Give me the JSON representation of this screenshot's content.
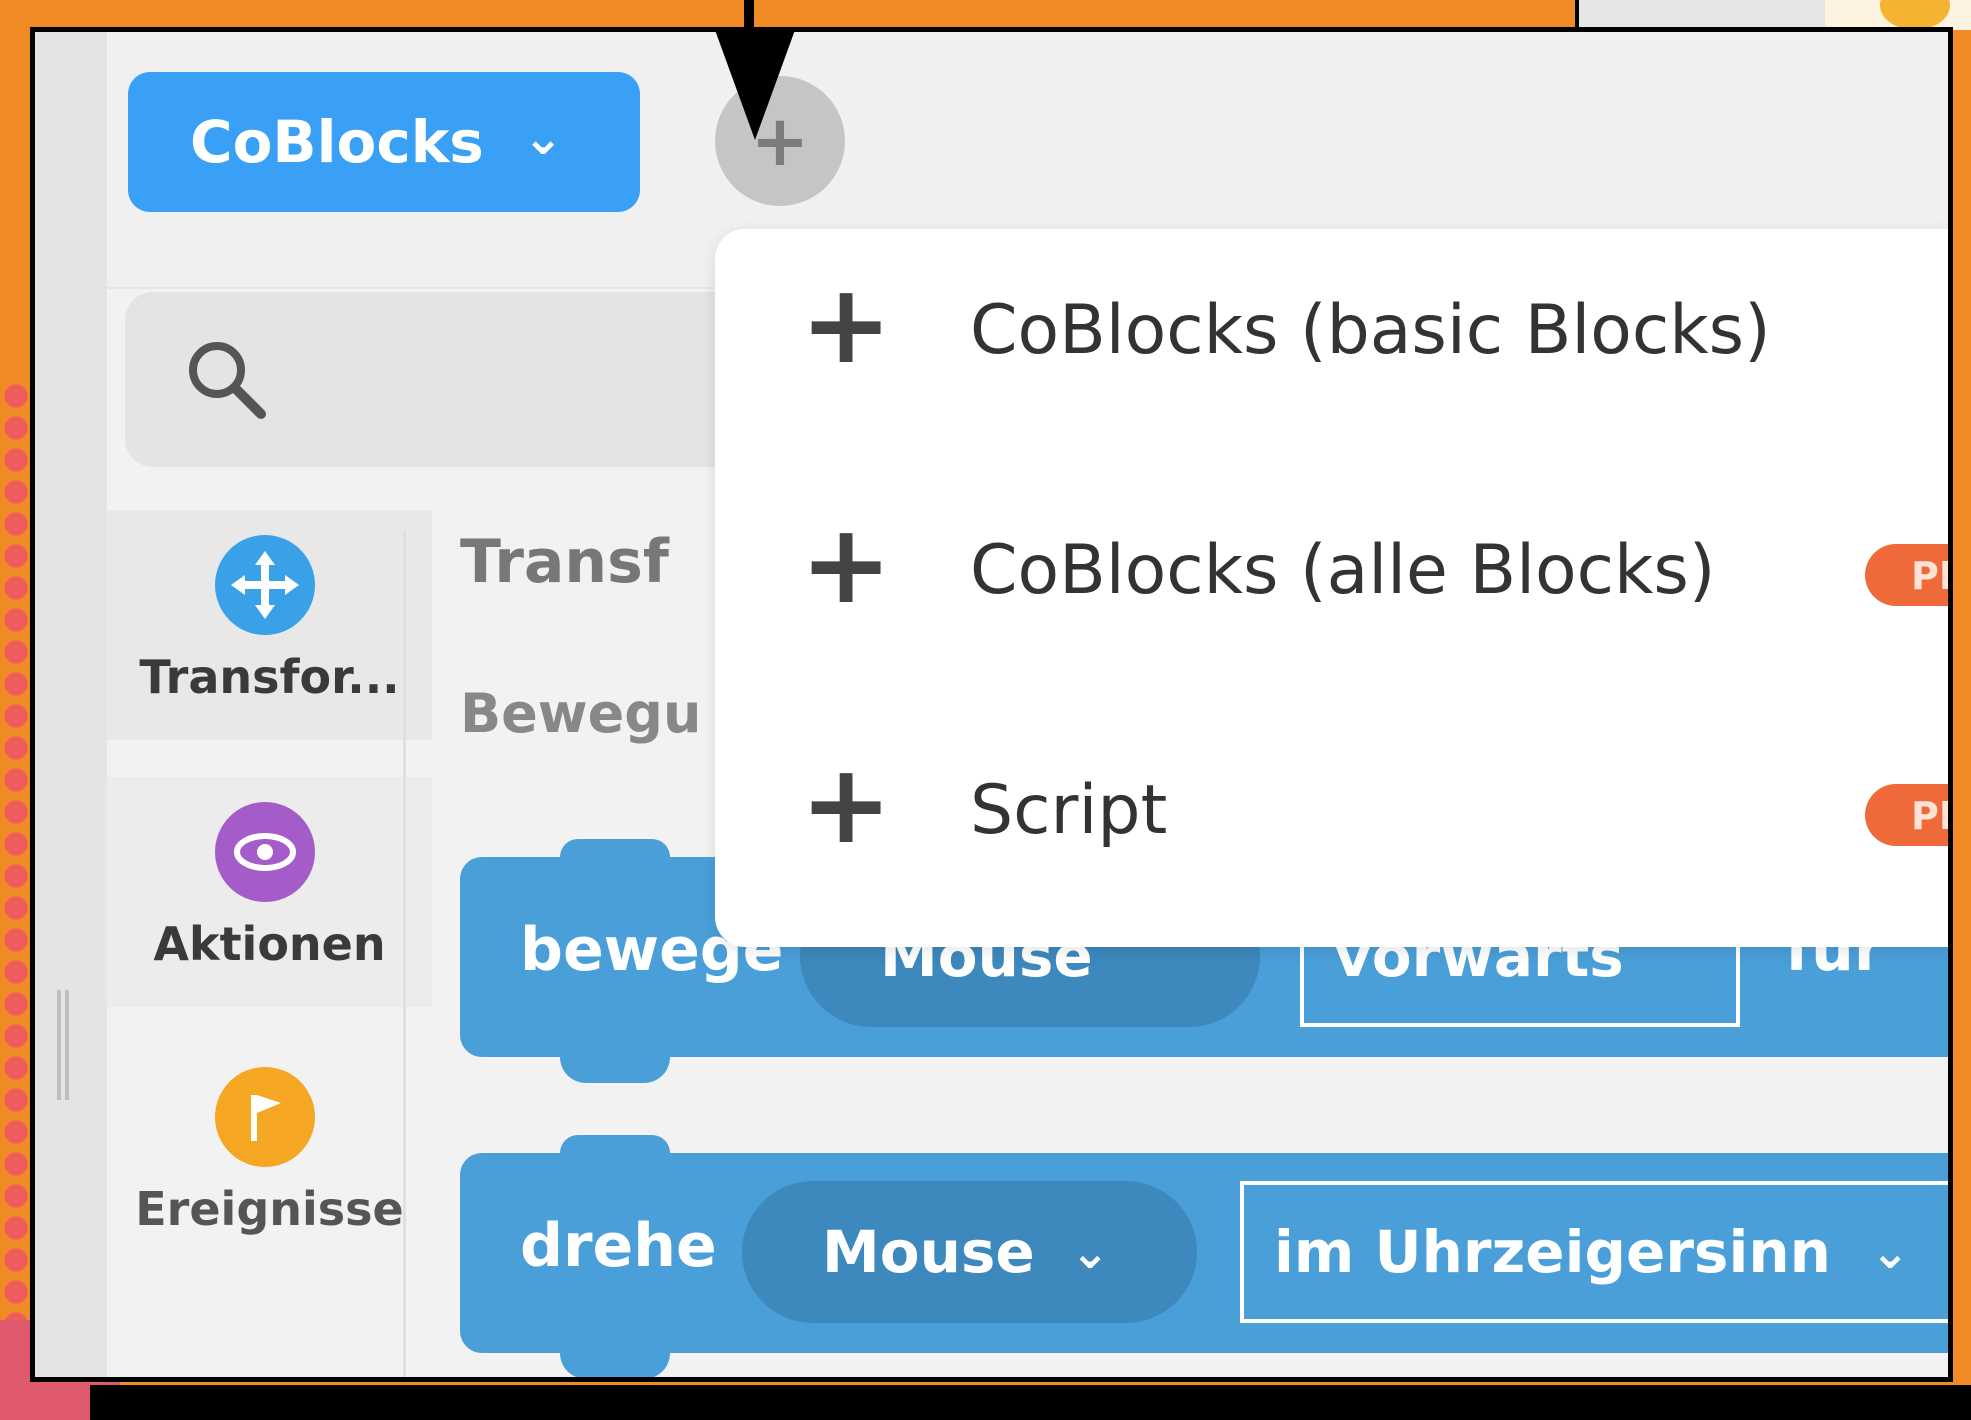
{
  "header": {
    "project_dropdown_label": "CoBlocks",
    "add_button_symbol": "+"
  },
  "search": {
    "placeholder": ""
  },
  "categories": [
    {
      "label": "Transfor...",
      "icon": "move-arrows-icon",
      "color": "#3aa0e8"
    },
    {
      "label": "Aktionen",
      "icon": "eye-icon",
      "color": "#a45cc9"
    },
    {
      "label": "Ereignisse",
      "icon": "flag-icon",
      "color": "#f5a623"
    }
  ],
  "section": {
    "title": "Transf",
    "subtitle": "Bewegu"
  },
  "blocks": [
    {
      "word": "bewege",
      "object": "Mouse",
      "direction": "vorwärts",
      "suffix": "für"
    },
    {
      "word": "drehe",
      "object": "Mouse",
      "direction": "im Uhrzeigersinn"
    }
  ],
  "add_menu": {
    "items": [
      {
        "label": "CoBlocks (basic Blocks)",
        "badge": ""
      },
      {
        "label": "CoBlocks (alle Blocks)",
        "badge": "PRO"
      },
      {
        "label": "Script",
        "badge": "PRO"
      }
    ]
  },
  "colors": {
    "accent_blue": "#3aa0f5",
    "block_blue": "#4a9fd8",
    "pro_badge": "#ef6a3a",
    "backdrop_orange": "#f08a24"
  }
}
